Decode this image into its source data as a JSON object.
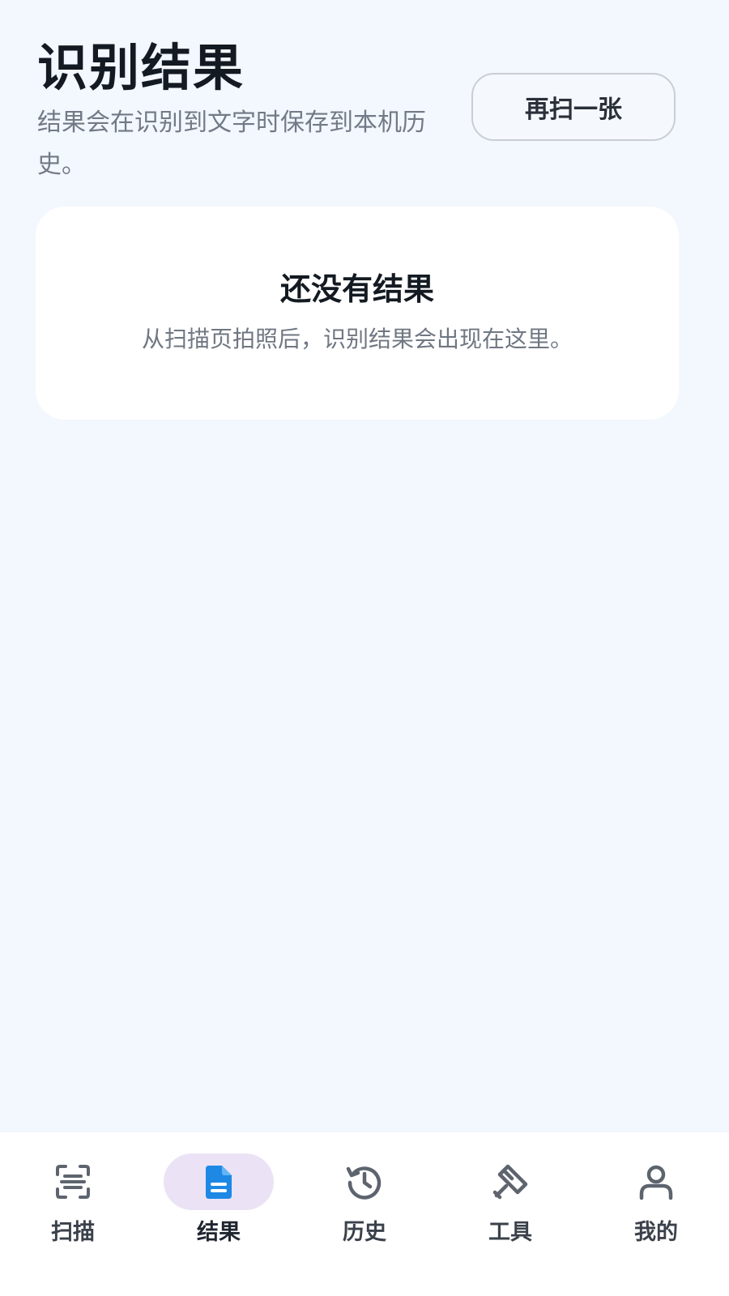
{
  "header": {
    "title": "识别结果",
    "subtitle": "结果会在识别到文字时保存到本机历史。",
    "rescan_label": "再扫一张"
  },
  "empty_state": {
    "title": "还没有结果",
    "description": "从扫描页拍照后，识别结果会出现在这里。"
  },
  "bottom_nav": {
    "active": "results",
    "items": [
      {
        "id": "scan",
        "label": "扫描",
        "icon": "scan-icon"
      },
      {
        "id": "results",
        "label": "结果",
        "icon": "document-icon"
      },
      {
        "id": "history",
        "label": "历史",
        "icon": "history-icon"
      },
      {
        "id": "tools",
        "label": "工具",
        "icon": "tools-icon"
      },
      {
        "id": "profile",
        "label": "我的",
        "icon": "person-icon"
      }
    ]
  },
  "colors": {
    "background": "#f3f7fe",
    "accent": "#1e88e5",
    "active_pill": "#ebe3f5",
    "icon_gray": "#5d646e"
  }
}
